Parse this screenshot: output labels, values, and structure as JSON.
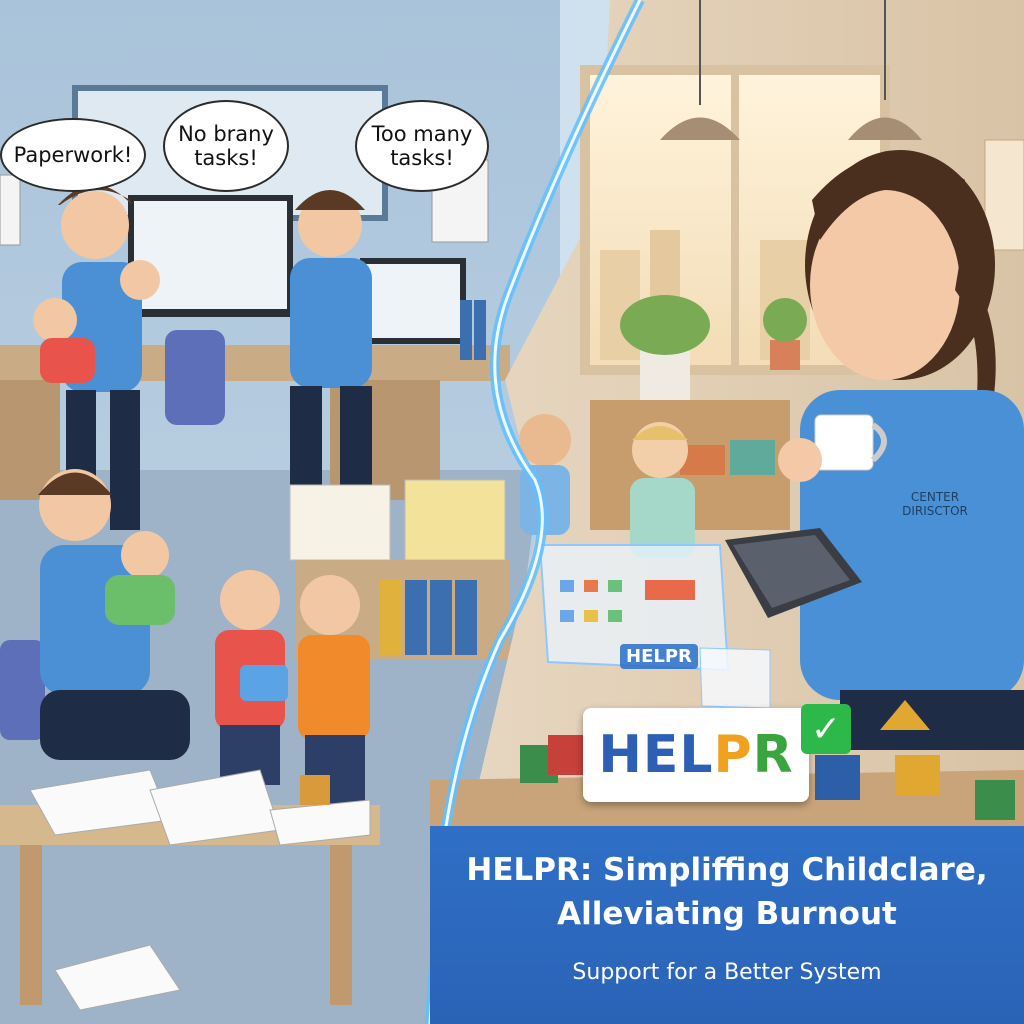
{
  "bubbles": {
    "left": "Paperwork!",
    "middle_line1": "No brany",
    "middle_line2": "tasks!",
    "right_line1": "Too many",
    "right_line2": "tasks!"
  },
  "shirt": {
    "line1": "CENTER",
    "line2": "DIRISCTOR"
  },
  "tablet_logo": "HELPR",
  "logo": {
    "part1": "HEL",
    "part2": "P",
    "part3": "R",
    "checkmark": "✓"
  },
  "banner": {
    "title_line1": "HELPR: Simpliffing Childclare,",
    "title_line2": "Alleviating Burnout",
    "subtitle": "Support for a Better System"
  },
  "colors": {
    "logo_blue": "#2d5fb4",
    "logo_orange": "#f0a11d",
    "logo_green": "#3aa53f",
    "banner_blue": "#2f6fc6",
    "check_green": "#2db84a"
  }
}
